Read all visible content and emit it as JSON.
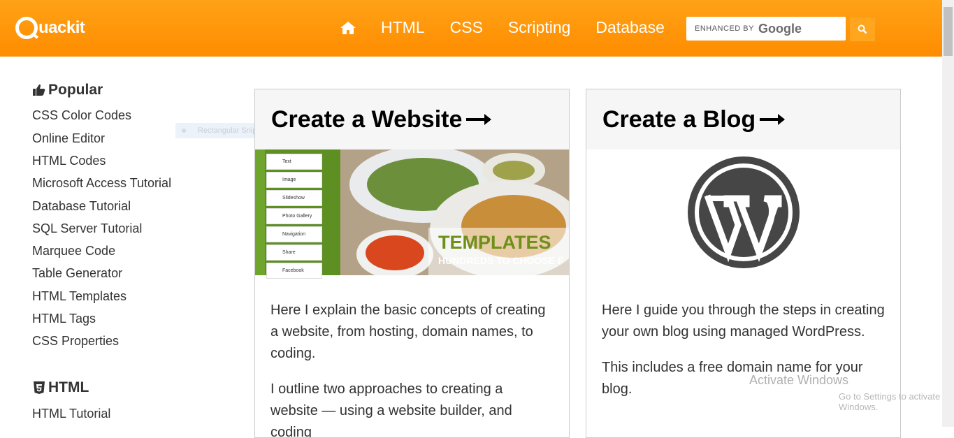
{
  "header": {
    "logo_text": "uackit",
    "nav": [
      "HTML",
      "CSS",
      "Scripting",
      "Database"
    ],
    "search": {
      "enhanced_by": "ENHANCED BY",
      "google": "Google"
    }
  },
  "sidebar": {
    "popular_heading": "Popular",
    "popular_items": [
      "CSS Color Codes",
      "Online Editor",
      "HTML Codes",
      "Microsoft Access Tutorial",
      "Database Tutorial",
      "SQL Server Tutorial",
      "Marquee Code",
      "Table Generator",
      "HTML Templates",
      "HTML Tags",
      "CSS Properties"
    ],
    "html_heading": "HTML",
    "html_items": [
      "HTML Tutorial"
    ]
  },
  "snip_label": "Rectangular Snip",
  "cards": {
    "website": {
      "title": "Create a Website",
      "builder_items": [
        "Text",
        "Image",
        "Slideshow",
        "Photo Gallery",
        "Navigation",
        "Share",
        "Facebook"
      ],
      "templates_label": "TEMPLATES",
      "templates_sub": "HUNDREDS TO CHOOSE F",
      "p1": "Here I explain the basic concepts of creating a website, from hosting, domain names, to coding.",
      "p2": "I outline two approaches to creating a website — using a website builder, and coding"
    },
    "blog": {
      "title": "Create a Blog",
      "p1": "Here I guide you through the steps in creating your own blog using managed WordPress.",
      "p2": "This includes a free domain name for your blog."
    }
  },
  "watermark": {
    "line1": "Activate Windows",
    "line2": "Go to Settings to activate Windows."
  },
  "colors": {
    "header": "#ff9800",
    "accent": "#ffa51e"
  }
}
